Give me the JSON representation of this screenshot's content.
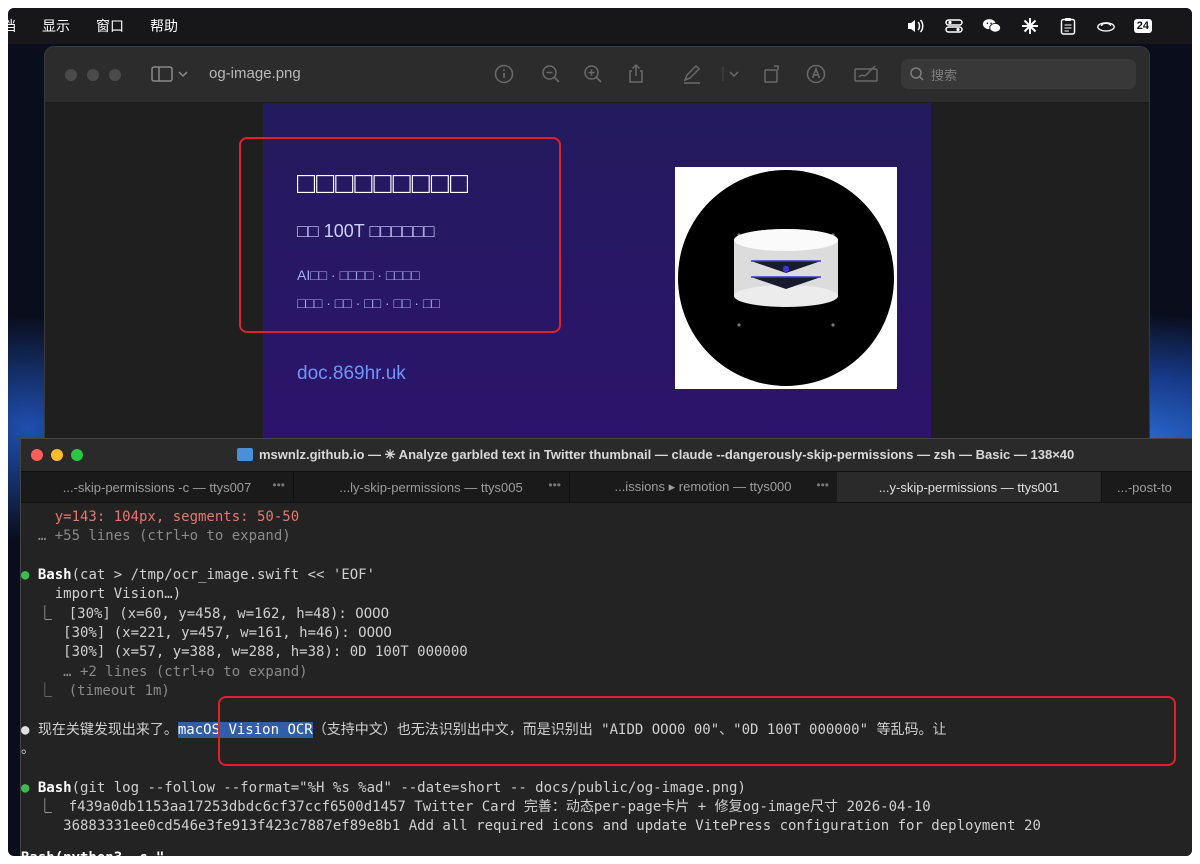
{
  "menubar": {
    "items": [
      "档",
      "显示",
      "窗口",
      "帮助"
    ],
    "icons": [
      "volume-icon",
      "control-center-icon",
      "wechat-icon",
      "sparkle-icon",
      "clipboard-icon",
      "cloud-icon"
    ],
    "date_badge": "24"
  },
  "preview": {
    "title": "og-image.png",
    "search_placeholder": "搜索",
    "og": {
      "title": "□□□□□□□□□",
      "subtitle": "□□ 100T □□□□□□",
      "tags_line1": "AI□□ · □□□□ · □□□□",
      "tags_line2": "□□□ · □□ · □□ · □□ · □□",
      "url": "doc.869hr.uk"
    }
  },
  "terminal": {
    "title": "mswnlz.github.io — ✳ Analyze garbled text in Twitter thumbnail — claude --dangerously-skip-permissions — zsh — Basic — 138×40",
    "tabs": [
      {
        "label": "...-skip-permissions -c — ttys007",
        "active": false
      },
      {
        "label": "...ly-skip-permissions — ttys005",
        "active": false
      },
      {
        "label": "...issions ▸ remotion — ttys000",
        "active": false
      },
      {
        "label": "...y-skip-permissions — ttys001",
        "active": true
      },
      {
        "label": "...-post-to",
        "active": false
      }
    ],
    "lines": {
      "l1": "    y=143: 104px, segments: 50-50",
      "l2": "  … +55 lines (ctrl+o to expand)",
      "l3_cmd": "Bash",
      "l3_rest": "(cat > /tmp/ocr_image.swift << 'EOF'",
      "l4": "    import Vision…)",
      "l5": "  ⎿  [30%] (x=60, y=458, w=162, h=48): OOOO",
      "l6": "     [30%] (x=221, y=457, w=161, h=46): OOOO",
      "l7": "     [30%] (x=57, y=388, w=288, h=38): 0D 100T 000000",
      "l8": "     … +2 lines (ctrl+o to expand)",
      "l9": "  ⎿  (timeout 1m)",
      "l10_pre": "现在关键发现出来了。",
      "l10_hl": "macOS Vision OCR",
      "l10_post": "（支持中文）也无法识别出中文，而是识别出 \"AIDD OOO0 00\"、\"0D 100T 000000\" 等乱码。让",
      "l11": "。",
      "l12_cmd": "Bash",
      "l12_rest": "(git log --follow --format=\"%H %s %ad\" --date=short -- docs/public/og-image.png)",
      "l13": "  ⎿  f439a0db1153aa17253dbdc6cf37ccf6500d1457 Twitter Card 完善：动态per-page卡片 + 修复og-image尺寸 2026-04-10",
      "l14": "     36883331ee0cd546e3fe913f423c7887ef89e8b1 Add all required icons and update VitePress configuration for deployment 20",
      "l15": "Bash(python3 -c \""
    }
  }
}
